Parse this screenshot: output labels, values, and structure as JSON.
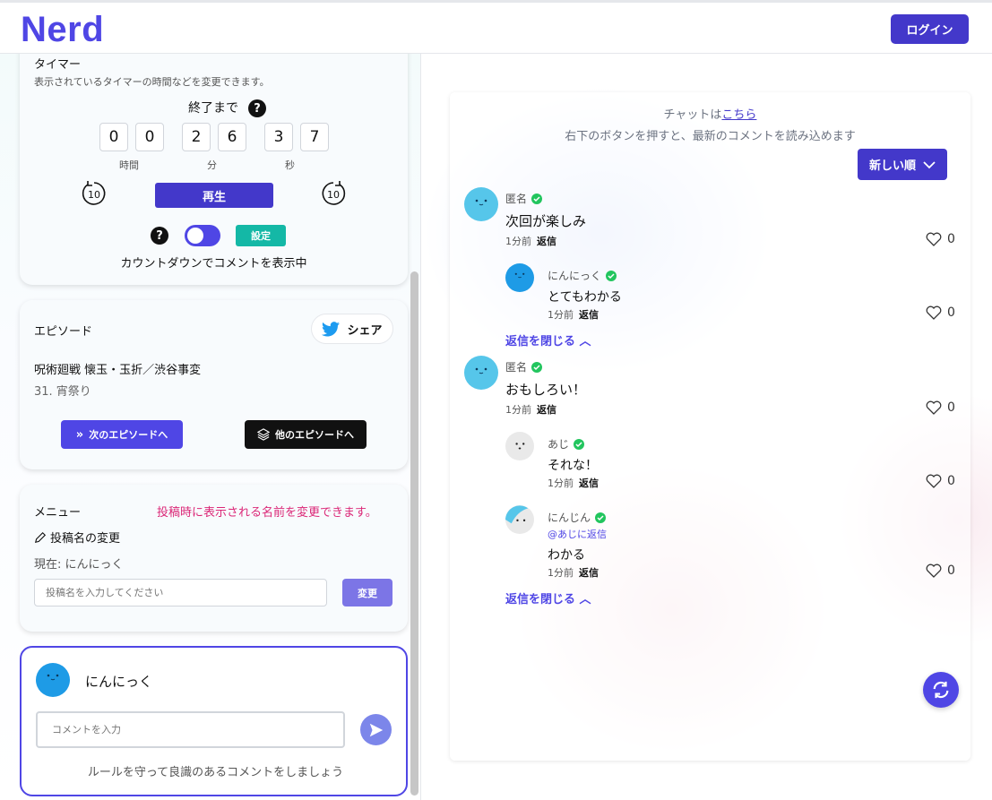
{
  "header": {
    "logo": "Nerd",
    "login_label": "ログイン"
  },
  "timer": {
    "title": "タイマー",
    "description": "表示されているタイマーの時間などを変更できます。",
    "until_label": "終了まで",
    "help_icon": "?",
    "digits": {
      "h1": "0",
      "h2": "0",
      "m1": "2",
      "m2": "6",
      "s1": "3",
      "s2": "7"
    },
    "units": {
      "hours": "時間",
      "minutes": "分",
      "seconds": "秒"
    },
    "rewind_label": "10",
    "forward_label": "10",
    "play_label": "再生",
    "setting_label": "設定",
    "status": "カウントダウンでコメントを表示中",
    "toggle_on": true
  },
  "episode": {
    "title": "エピソード",
    "share_label": "シェア",
    "series": "呪術廻戦 懐玉・玉折／渋谷事変",
    "episode_name": "31. 宵祭り",
    "next_label": "次のエピソードへ",
    "other_label": "他のエピソードへ"
  },
  "menu": {
    "title": "メニュー",
    "hint": "投稿時に表示される名前を変更できます。",
    "rename_label": "投稿名の変更",
    "current_name": "現在: にんにっく",
    "name_placeholder": "投稿名を入力してください",
    "change_label": "変更"
  },
  "post": {
    "username": "にんにっく",
    "comment_placeholder": "コメントを入力",
    "rule": "ルールを守って良識のあるコメントをしましょう"
  },
  "chat": {
    "link_prefix": "チャットは",
    "link_text": "こちら",
    "info": "右下のボタンを押すと、最新のコメントを読み込めます",
    "sort_label": "新しい順",
    "close_replies_label": "返信を閉じる",
    "reply_label": "返信",
    "comments": [
      {
        "name": "匿名",
        "text": "次回が楽しみ",
        "time": "1分前",
        "likes": "0"
      },
      {
        "name": "にんにっく",
        "text": "とてもわかる",
        "time": "1分前",
        "likes": "0"
      },
      {
        "name": "匿名",
        "text": "おもしろい！",
        "time": "1分前",
        "likes": "0"
      },
      {
        "name": "あじ",
        "text": "それな！",
        "time": "1分前",
        "likes": "0"
      },
      {
        "name": "にんじん",
        "mention": "@あじに返信",
        "text": "わかる",
        "time": "1分前",
        "likes": "0"
      }
    ]
  },
  "colors": {
    "accent": "#4f46e5",
    "accent_dark": "#4338ca",
    "teal": "#14b8a6",
    "hint_pink": "#db2777"
  }
}
